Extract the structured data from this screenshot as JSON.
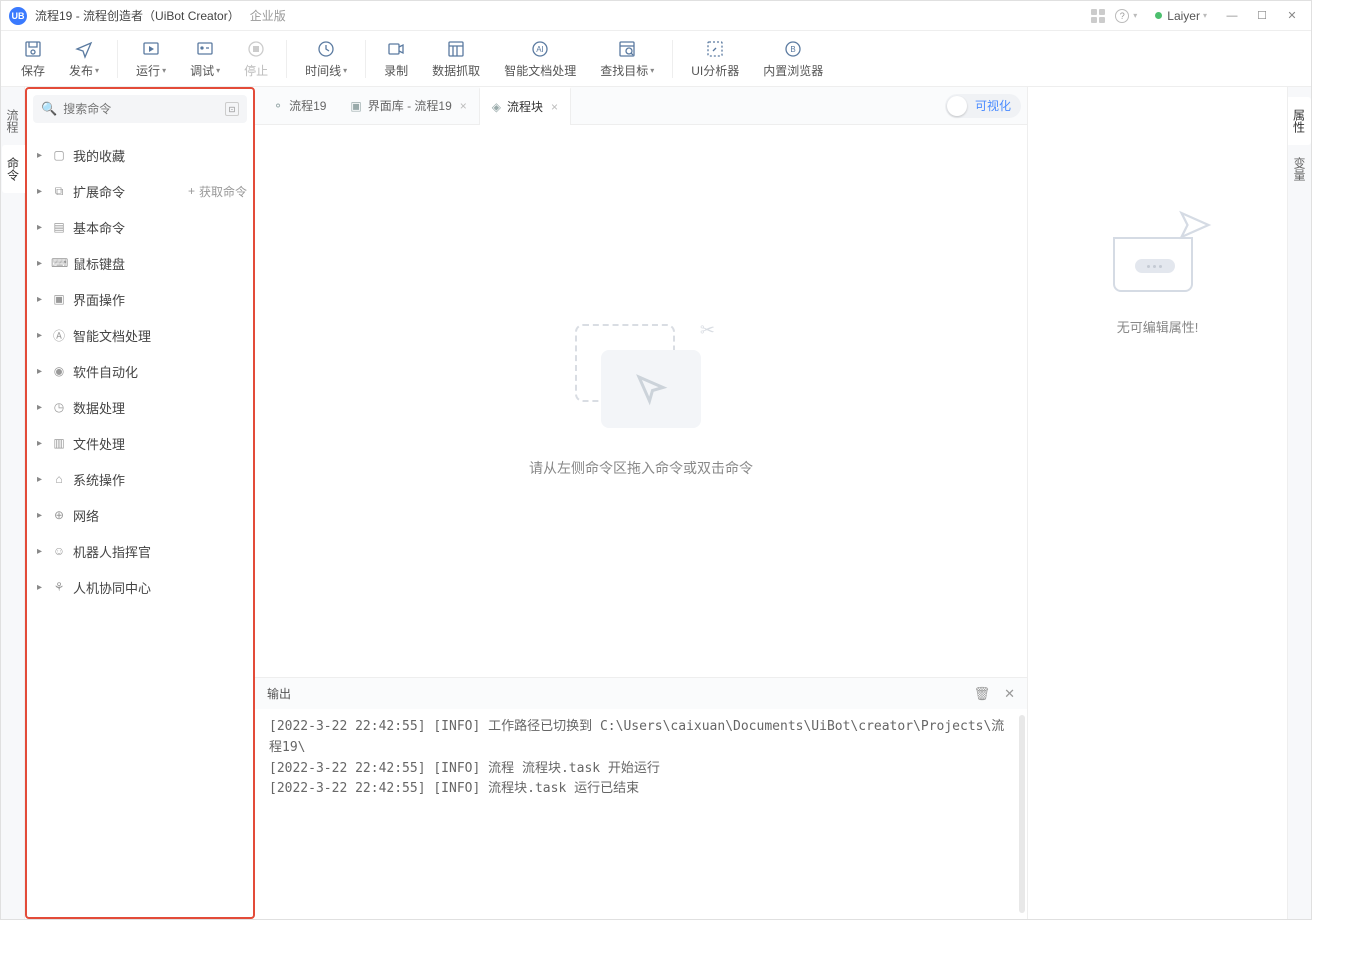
{
  "title": {
    "project": "流程19",
    "app_name": "流程创造者（UiBot Creator）",
    "edition": "企业版",
    "user": "Laiyer"
  },
  "toolbar": {
    "save": "保存",
    "publish": "发布",
    "run": "运行",
    "debug": "调试",
    "stop": "停止",
    "timeline": "时间线",
    "record": "录制",
    "capture": "数据抓取",
    "idp": "智能文档处理",
    "find_target": "查找目标",
    "ui_analyzer": "UI分析器",
    "builtin_browser": "内置浏览器"
  },
  "left_tabs": {
    "flow": "流程",
    "cmd": "命令"
  },
  "right_tabs": {
    "prop": "属性",
    "var": "变量"
  },
  "search": {
    "placeholder": "搜索命令"
  },
  "tree": {
    "items": [
      {
        "icon": "▢",
        "label": "我的收藏"
      },
      {
        "icon": "⧉",
        "label": "扩展命令",
        "extra": "获取命令"
      },
      {
        "icon": "▤",
        "label": "基本命令"
      },
      {
        "icon": "⌨",
        "label": "鼠标键盘"
      },
      {
        "icon": "▣",
        "label": "界面操作"
      },
      {
        "icon": "Ⓐ",
        "label": "智能文档处理"
      },
      {
        "icon": "◉",
        "label": "软件自动化"
      },
      {
        "icon": "◷",
        "label": "数据处理"
      },
      {
        "icon": "▥",
        "label": "文件处理"
      },
      {
        "icon": "⌂",
        "label": "系统操作"
      },
      {
        "icon": "⊕",
        "label": "网络"
      },
      {
        "icon": "☺",
        "label": "机器人指挥官"
      },
      {
        "icon": "⚘",
        "label": "人机协同中心"
      }
    ]
  },
  "tabs": [
    {
      "icon": "⚬",
      "label": "流程19",
      "active": false,
      "close": false
    },
    {
      "icon": "▣",
      "label": "界面库 - 流程19",
      "active": false,
      "close": true
    },
    {
      "icon": "◈",
      "label": "流程块",
      "active": true,
      "close": true
    }
  ],
  "visual_toggle": "可视化",
  "canvas_hint": "请从左侧命令区拖入命令或双击命令",
  "output": {
    "title": "输出",
    "lines": [
      "[2022-3-22 22:42:55] [INFO] 工作路径已切换到 C:\\Users\\caixuan\\Documents\\UiBot\\creator\\Projects\\流程19\\",
      "[2022-3-22 22:42:55] [INFO] 流程 流程块.task 开始运行",
      "[2022-3-22 22:42:55] [INFO] 流程块.task 运行已结束"
    ]
  },
  "prop_panel": {
    "empty_text": "无可编辑属性!"
  }
}
